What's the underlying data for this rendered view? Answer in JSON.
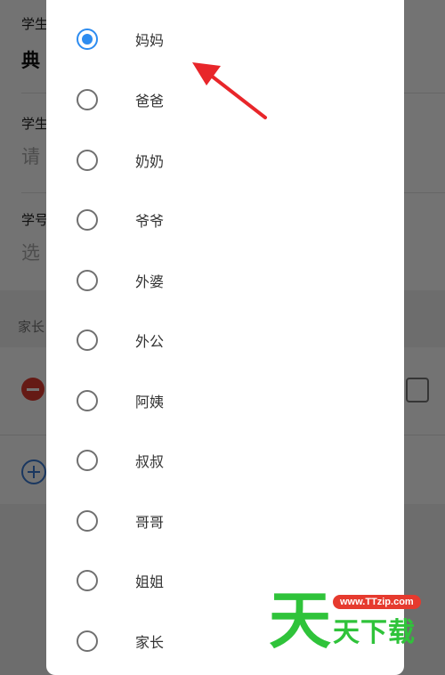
{
  "background_form": {
    "student_name_label": "学生",
    "student_name_value": "典",
    "student_grade_label": "学生",
    "student_grade_placeholder": "请",
    "student_id_label": "学号",
    "student_id_placeholder": "选",
    "parent_section_label": "家长"
  },
  "relation_options": [
    {
      "label": "妈妈",
      "checked": true
    },
    {
      "label": "爸爸",
      "checked": false
    },
    {
      "label": "奶奶",
      "checked": false
    },
    {
      "label": "爷爷",
      "checked": false
    },
    {
      "label": "外婆",
      "checked": false
    },
    {
      "label": "外公",
      "checked": false
    },
    {
      "label": "阿姨",
      "checked": false
    },
    {
      "label": "叔叔",
      "checked": false
    },
    {
      "label": "哥哥",
      "checked": false
    },
    {
      "label": "姐姐",
      "checked": false
    },
    {
      "label": "家长",
      "checked": false
    }
  ],
  "watermark": {
    "big_char": "天",
    "url": "www.TTzip.com",
    "small_text": "天下载"
  },
  "colors": {
    "accent": "#2d8cf0",
    "annotation_arrow": "#e8262a",
    "watermark_green": "#2fc33a",
    "watermark_red": "#e63a2e"
  }
}
